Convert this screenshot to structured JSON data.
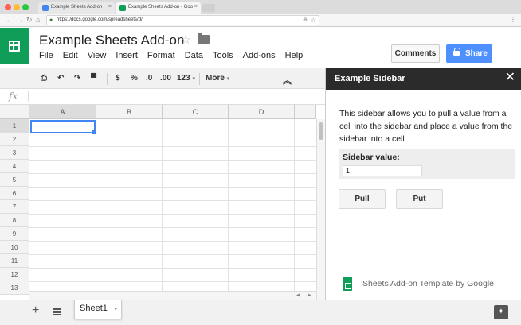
{
  "browser": {
    "tabs": [
      {
        "label": "Example Sheets Add-on",
        "favicon_color": "#4285f4"
      },
      {
        "label": "Example Sheets Add-on - Goo",
        "favicon_color": "#0f9d58"
      }
    ],
    "url": "https://docs.google.com/spreadsheets/d/",
    "traffic_colors": [
      "#ff5f57",
      "#febc2e",
      "#28c840"
    ]
  },
  "doc": {
    "title": "Example Sheets Add-on",
    "menu": [
      "File",
      "Edit",
      "View",
      "Insert",
      "Format",
      "Data",
      "Tools",
      "Add-ons",
      "Help"
    ],
    "comments_label": "Comments",
    "share_label": "Share"
  },
  "toolbar": {
    "currency": "$",
    "percent": "%",
    "dec_decrease": ".0",
    "dec_increase": ".00",
    "number_format": "123",
    "more": "More"
  },
  "formula_bar": {
    "fx_label": "fx"
  },
  "grid": {
    "columns": [
      "A",
      "B",
      "C",
      "D"
    ],
    "rows": [
      "1",
      "2",
      "3",
      "4",
      "5",
      "6",
      "7",
      "8",
      "9",
      "10",
      "11",
      "12",
      "13"
    ],
    "selected_cell": "A1"
  },
  "bottom": {
    "sheet_name": "Sheet1"
  },
  "sidebar": {
    "title": "Example Sidebar",
    "description": "This sidebar allows you to pull a value from a cell into the sidebar and place a value from the sidebar into a cell.",
    "value_label": "Sidebar value:",
    "value": "1",
    "pull_label": "Pull",
    "put_label": "Put",
    "footer": "Sheets Add-on Template by Google"
  }
}
